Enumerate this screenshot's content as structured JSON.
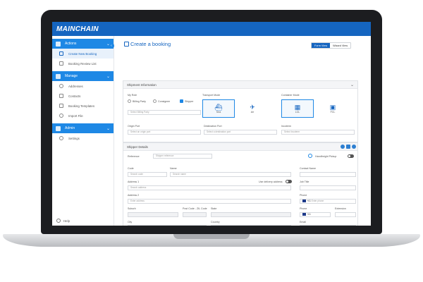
{
  "app": {
    "logo": "MAINCHAIN"
  },
  "sidebar": {
    "groups": [
      {
        "label": "Actions",
        "items": [
          "Create New Booking",
          "Booking Review List"
        ]
      },
      {
        "label": "Manage",
        "items": [
          "Addresses",
          "Contacts",
          "Booking Templates",
          "Import File"
        ]
      },
      {
        "label": "Admin",
        "items": [
          "Settings"
        ]
      }
    ],
    "footer": "Help"
  },
  "header": {
    "title": "Create a booking",
    "view_primary": "Form View",
    "view_secondary": "Wizard View"
  },
  "shipment": {
    "section_title": "Shipment Information",
    "my_role_label": "My Role",
    "roles": [
      "Billing Party",
      "Consignee",
      "Shipper"
    ],
    "role_select_placeholder": "Select Billing Party",
    "transport_mode_label": "Transport Mode",
    "transport_modes": [
      "Sea",
      "Air"
    ],
    "container_mode_label": "Container Mode",
    "container_modes": [
      "LCL",
      "FCL"
    ],
    "origin_port_label": "Origin Port",
    "origin_port_placeholder": "Select an origin port",
    "destination_port_label": "Destination Port",
    "destination_port_placeholder": "Select a destination port",
    "incoterm_label": "Incoterm",
    "incoterm_placeholder": "Select Incoterm"
  },
  "shipper": {
    "section_title": "Shipper Details",
    "reference_label": "Reference",
    "reference_placeholder": "Shipper reference",
    "handfreight_label": "Handfreight Pickup",
    "code_label": "Code",
    "code_placeholder": "Search code",
    "name_label": "Name",
    "name_placeholder": "Search name",
    "contact_name_label": "Contact Name",
    "address1_label": "Address 1",
    "address1_placeholder": "Search address",
    "use_delivery_label": "Use delivery address",
    "job_title_label": "Job Title",
    "address2_label": "Address 2",
    "address2_placeholder": "Enter address",
    "phone_label": "Phone",
    "phone_code": "+61",
    "phone_placeholder": "Enter phone",
    "suburb_label": "Suburb",
    "postcode_label": "Post Code - ZIL Code",
    "state_label": "State",
    "phone2_label": "Phone",
    "extension_label": "Extension",
    "city_label": "City",
    "country_label": "Country",
    "email_label": "Email"
  }
}
